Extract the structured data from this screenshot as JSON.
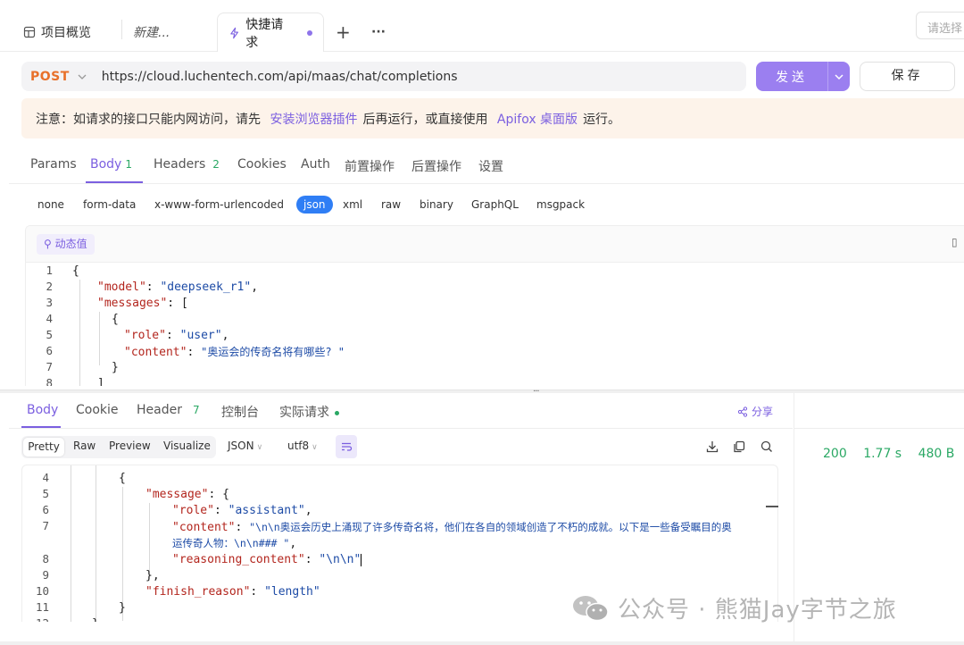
{
  "tabs": {
    "overview": "项目概览",
    "new": "新建...",
    "active": "快捷请求",
    "add": "+",
    "more": "···",
    "env_select": "请选择"
  },
  "request": {
    "method": "POST",
    "url": "https://cloud.luchentech.com/api/maas/chat/completions",
    "send": "发送",
    "save": "保存"
  },
  "notice": {
    "prefix": "注意：如请求的接口只能内网访问，请先",
    "link1": "安装浏览器插件",
    "middle": "后再运行，或直接使用",
    "link2": "Apifox 桌面版",
    "suffix": "运行。"
  },
  "req_tabs": [
    {
      "label": "Params",
      "count": ""
    },
    {
      "label": "Body",
      "count": "1"
    },
    {
      "label": "Headers",
      "count": "2"
    },
    {
      "label": "Cookies",
      "count": ""
    },
    {
      "label": "Auth",
      "count": ""
    },
    {
      "label": "前置操作",
      "count": ""
    },
    {
      "label": "后置操作",
      "count": ""
    },
    {
      "label": "设置",
      "count": ""
    }
  ],
  "body_types": [
    "none",
    "form-data",
    "x-www-form-urlencoded",
    "json",
    "xml",
    "raw",
    "binary",
    "GraphQL",
    "msgpack"
  ],
  "dynamic_value": "动态值",
  "req_code": {
    "l1": "{",
    "l2k": "\"model\"",
    "l2v": "\"deepseek_r1\"",
    "l3k": "\"messages\"",
    "l3v": "[",
    "l4": "{",
    "l5k": "\"role\"",
    "l5v": "\"user\"",
    "l6k": "\"content\"",
    "l6v": "\"奥运会的传奇名将有哪些? \"",
    "l7": "}",
    "l8": "]",
    "nums": [
      "1",
      "2",
      "3",
      "4",
      "5",
      "6",
      "7",
      "8"
    ]
  },
  "resp_tabs": {
    "body": "Body",
    "cookie": "Cookie",
    "header": "Header",
    "header_count": "7",
    "console": "控制台",
    "actual": "实际请求",
    "share": "分享"
  },
  "resp_format": {
    "pretty": "Pretty",
    "raw": "Raw",
    "preview": "Preview",
    "visualize": "Visualize",
    "type": "JSON",
    "encoding": "utf8"
  },
  "status": {
    "code": "200",
    "time": "1.77 s",
    "size": "480 B"
  },
  "resp_code": {
    "nums": [
      "4",
      "5",
      "6",
      "7",
      "",
      "8",
      "9",
      "10",
      "11",
      "12"
    ],
    "l4": "{",
    "l5k": "\"message\"",
    "l5v": "{",
    "l6k": "\"role\"",
    "l6v": "\"assistant\"",
    "l7k": "\"content\"",
    "l7v": "\"\\n\\n奥运会历史上涌现了许多传奇名将，他们在各自的领域创造了不朽的成就。以下是一些备受瞩目的奥",
    "l7v2": "运传奇人物：\\n\\n### \"",
    "l8k": "\"reasoning_content\"",
    "l8v": "\"\\n\\n\"",
    "l9": "},",
    "l10k": "\"finish_reason\"",
    "l10v": "\"length\"",
    "l11": "}",
    "l12": "}"
  },
  "watermark": "公众号 · 熊猫Jay字节之旅"
}
